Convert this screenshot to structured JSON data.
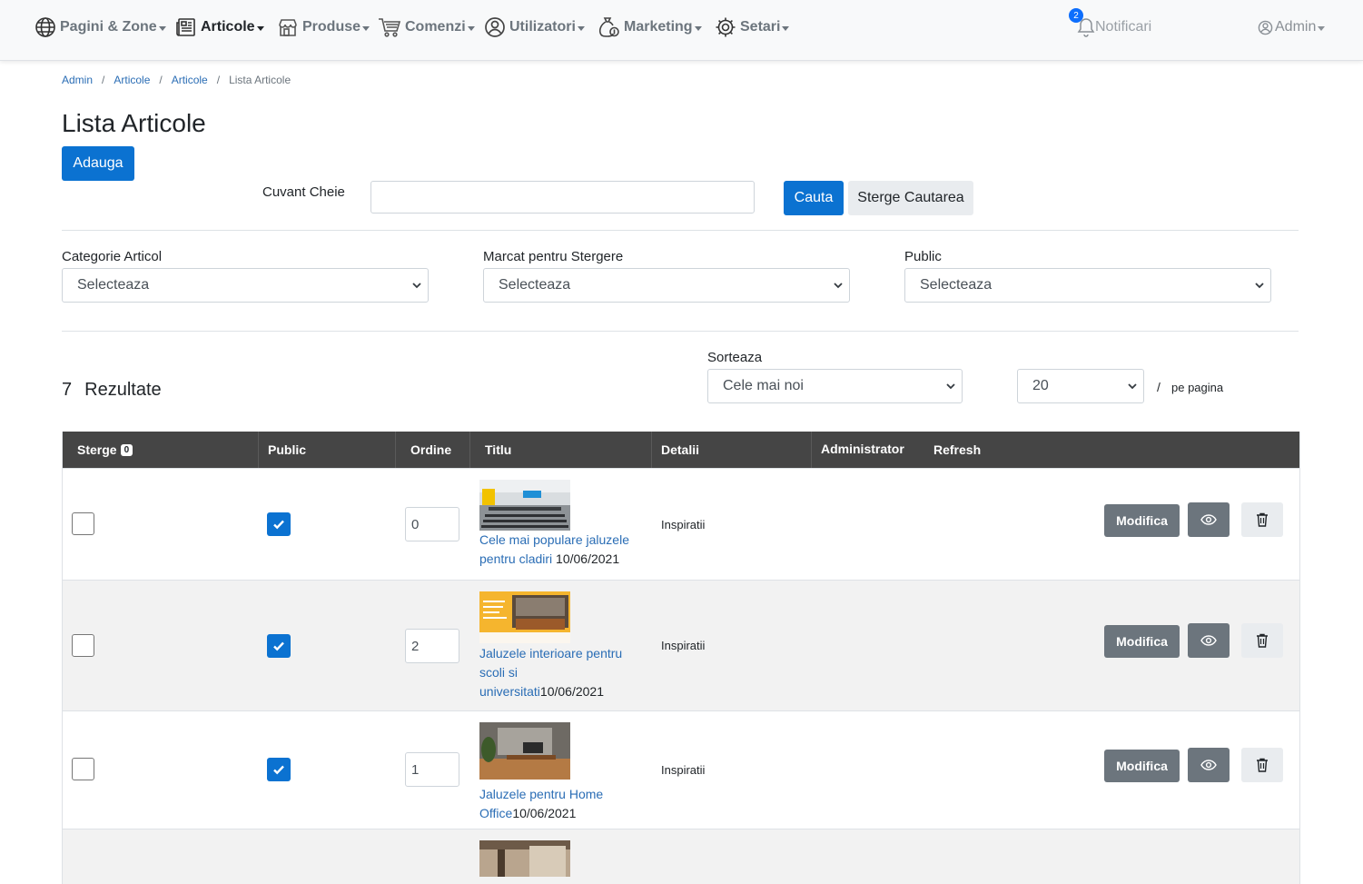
{
  "nav": {
    "items": [
      {
        "label": "Pagini & Zone",
        "icon": "globe-icon"
      },
      {
        "label": "Articole",
        "icon": "newspaper-icon",
        "active": true
      },
      {
        "label": "Produse",
        "icon": "shop-icon"
      },
      {
        "label": "Comenzi",
        "icon": "cart-icon"
      },
      {
        "label": "Utilizatori",
        "icon": "user-circle-icon"
      },
      {
        "label": "Marketing",
        "icon": "money-bag-icon"
      },
      {
        "label": "Setari",
        "icon": "gear-icon"
      }
    ],
    "notifications_label": "Notificari",
    "notifications_count": "2",
    "admin_label": "Admin"
  },
  "breadcrumb": [
    "Admin",
    "Articole",
    "Articole",
    "Lista Articole"
  ],
  "page_title": "Lista Articole",
  "add_button": "Adauga",
  "search": {
    "label": "Cuvant Cheie",
    "value": "",
    "search_button": "Cauta",
    "clear_button": "Sterge Cautarea"
  },
  "filters": {
    "category_label": "Categorie Articol",
    "category_value": "Selecteaza",
    "marked_label": "Marcat pentru Stergere",
    "marked_value": "Selecteaza",
    "public_label": "Public",
    "public_value": "Selecteaza"
  },
  "results": {
    "count": "7",
    "label": "Rezultate",
    "sort_label": "Sorteaza",
    "sort_value": "Cele mai noi",
    "per_page_value": "20",
    "slash": "/",
    "per_page_label": "pe pagina"
  },
  "table": {
    "headers": {
      "delete": "Sterge",
      "delete_count": "0",
      "public": "Public",
      "order": "Ordine",
      "title": "Titlu",
      "details": "Detalii",
      "admin": "Administrator",
      "refresh": "Refresh"
    },
    "rows": [
      {
        "deleted": false,
        "public": true,
        "order": "0",
        "title": "Cele mai populare jaluzele pentru cladiri",
        "date": "10/06/2021",
        "details": "Inspiratii",
        "edit": "Modifica"
      },
      {
        "deleted": false,
        "public": true,
        "order": "2",
        "title": "Jaluzele interioare pentru scoli si universitati",
        "date": "10/06/2021",
        "details": "Inspiratii",
        "edit": "Modifica"
      },
      {
        "deleted": false,
        "public": true,
        "order": "1",
        "title": "Jaluzele pentru Home Office",
        "date": "10/06/2021",
        "details": "Inspiratii",
        "edit": "Modifica"
      }
    ]
  },
  "colors": {
    "primary": "#0b72d1",
    "header_bg": "#454545",
    "secondary": "#6c757d",
    "link": "#2a6db5"
  }
}
